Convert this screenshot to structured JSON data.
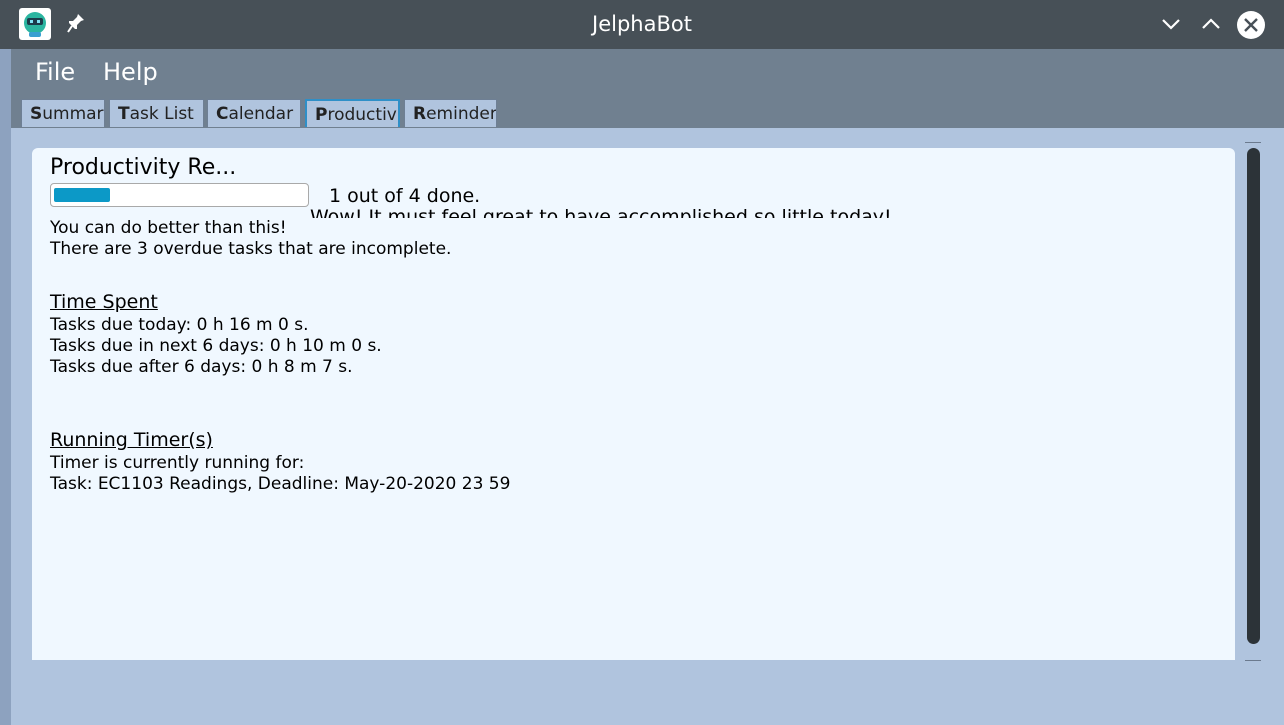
{
  "window": {
    "title": "JelphaBot"
  },
  "menu": {
    "items": [
      "File",
      "Help"
    ]
  },
  "tabs": [
    {
      "mnemonic": "S",
      "rest": "ummary"
    },
    {
      "mnemonic": "T",
      "rest": "ask List"
    },
    {
      "mnemonic": "C",
      "rest": "alendar"
    },
    {
      "mnemonic": "P",
      "rest": "roductivi"
    },
    {
      "mnemonic": "R",
      "rest": "eminder"
    }
  ],
  "productivity": {
    "title": "Productivity Re...",
    "progress": {
      "done": 1,
      "total": 4,
      "fraction": 0.25,
      "label": "1 out of 4 done."
    },
    "comment": "Wow! It must feel great to have accomplished so little today!",
    "encouragement": "You can do better than this!",
    "overdue": "There are 3 overdue tasks that are incomplete."
  },
  "time_spent": {
    "heading": "Time Spent",
    "lines": [
      "Tasks due today: 0 h 16 m 0 s.",
      "Tasks due in next 6 days: 0 h 10 m 0 s.",
      "Tasks due after 6 days: 0 h 8 m 7 s."
    ]
  },
  "running_timers": {
    "heading": "Running Timer(s)",
    "status": "Timer is currently running for:",
    "task": "Task: EC1103 Readings, Deadline: May-20-2020 23 59"
  },
  "colors": {
    "titlebar": "#475057",
    "menubar": "#708090",
    "background": "#b0c4de",
    "panel": "#f0f8ff",
    "progress": "#0c99c7"
  }
}
